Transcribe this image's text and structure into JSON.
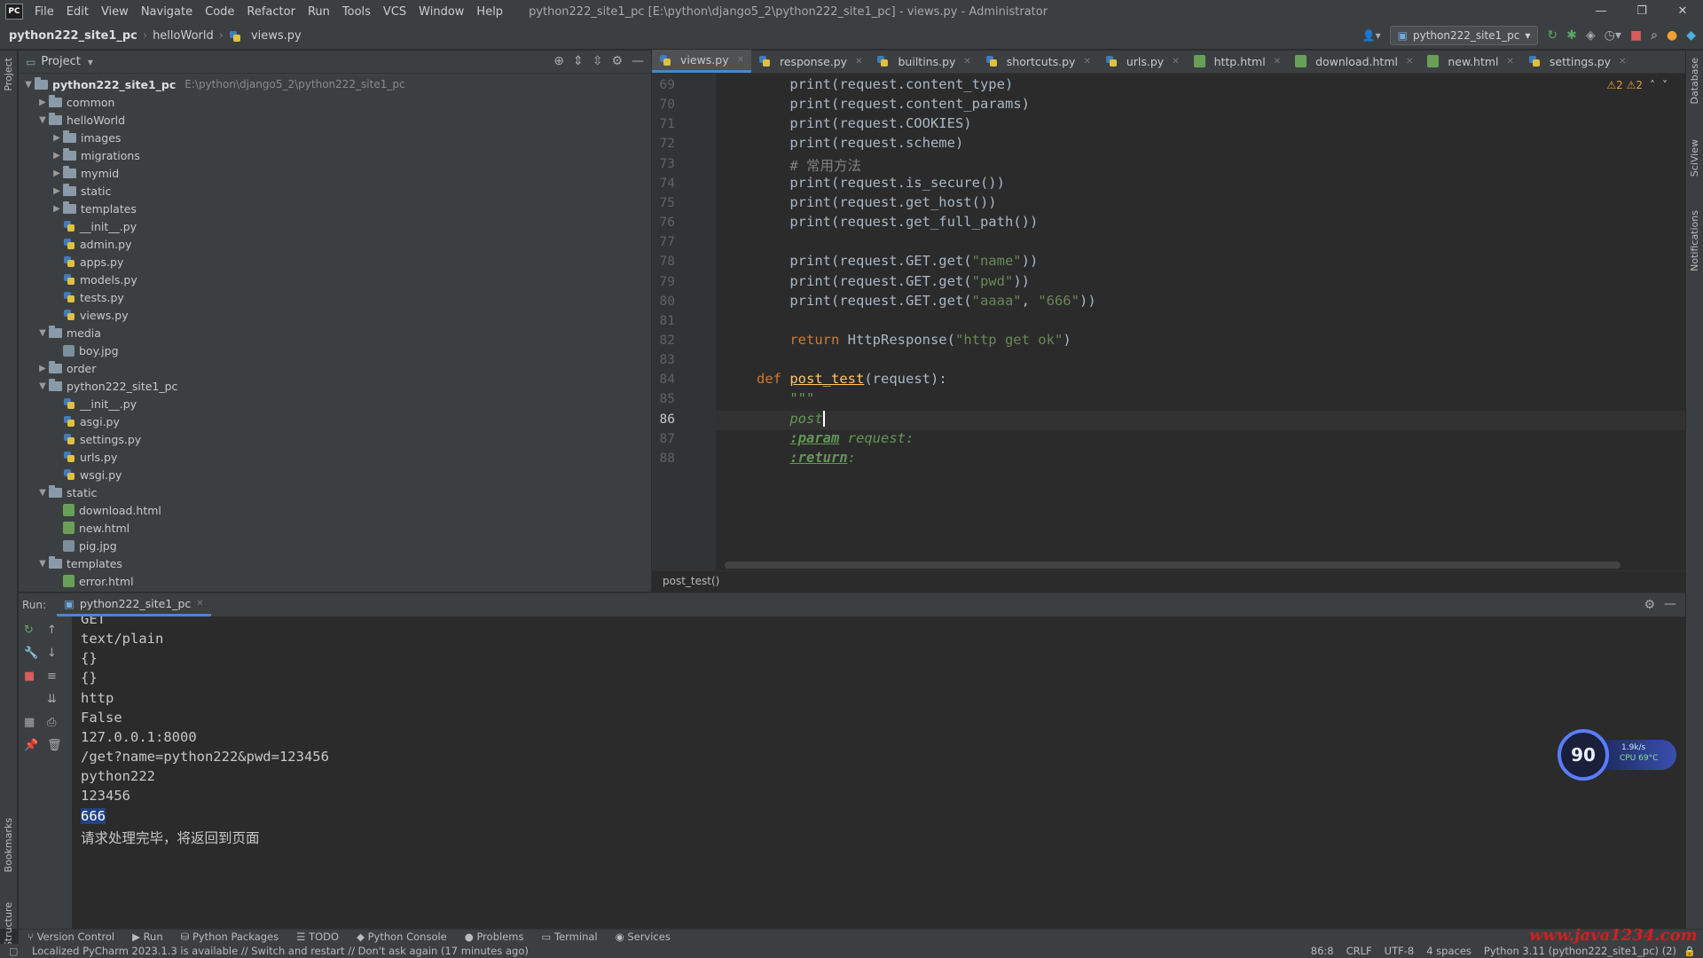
{
  "app": {
    "logo": "PC",
    "menu": [
      "File",
      "Edit",
      "View",
      "Navigate",
      "Code",
      "Refactor",
      "Run",
      "Tools",
      "VCS",
      "Window",
      "Help"
    ],
    "window_title": "python222_site1_pc [E:\\python\\django5_2\\python222_site1_pc] - views.py - Administrator"
  },
  "nav": {
    "project": "python222_site1_pc",
    "folder": "helloWorld",
    "file": "views.py",
    "run_config": "python222_site1_pc"
  },
  "project_panel": {
    "title": "Project",
    "root_name": "python222_site1_pc",
    "root_path": "E:\\python\\django5_2\\python222_site1_pc",
    "items": [
      {
        "name": "common",
        "type": "folder",
        "depth": 1,
        "open": false
      },
      {
        "name": "helloWorld",
        "type": "folder",
        "depth": 1,
        "open": true
      },
      {
        "name": "images",
        "type": "folder",
        "depth": 2,
        "open": false
      },
      {
        "name": "migrations",
        "type": "folder",
        "depth": 2,
        "open": false
      },
      {
        "name": "mymid",
        "type": "folder",
        "depth": 2,
        "open": false
      },
      {
        "name": "static",
        "type": "folder",
        "depth": 2,
        "open": false
      },
      {
        "name": "templates",
        "type": "folder",
        "depth": 2,
        "open": false
      },
      {
        "name": "__init__.py",
        "type": "py",
        "depth": 2
      },
      {
        "name": "admin.py",
        "type": "py",
        "depth": 2
      },
      {
        "name": "apps.py",
        "type": "py",
        "depth": 2
      },
      {
        "name": "models.py",
        "type": "py",
        "depth": 2
      },
      {
        "name": "tests.py",
        "type": "py",
        "depth": 2
      },
      {
        "name": "views.py",
        "type": "py",
        "depth": 2
      },
      {
        "name": "media",
        "type": "folder",
        "depth": 1,
        "open": true
      },
      {
        "name": "boy.jpg",
        "type": "img",
        "depth": 2
      },
      {
        "name": "order",
        "type": "folder",
        "depth": 1,
        "open": false
      },
      {
        "name": "python222_site1_pc",
        "type": "folder",
        "depth": 1,
        "open": true
      },
      {
        "name": "__init__.py",
        "type": "py",
        "depth": 2
      },
      {
        "name": "asgi.py",
        "type": "py",
        "depth": 2
      },
      {
        "name": "settings.py",
        "type": "py",
        "depth": 2
      },
      {
        "name": "urls.py",
        "type": "py",
        "depth": 2
      },
      {
        "name": "wsgi.py",
        "type": "py",
        "depth": 2
      },
      {
        "name": "static",
        "type": "folder",
        "depth": 1,
        "open": true
      },
      {
        "name": "download.html",
        "type": "html",
        "depth": 2
      },
      {
        "name": "new.html",
        "type": "html",
        "depth": 2
      },
      {
        "name": "pig.jpg",
        "type": "img",
        "depth": 2
      },
      {
        "name": "templates",
        "type": "folder",
        "depth": 1,
        "open": true
      },
      {
        "name": "error.html",
        "type": "html",
        "depth": 2
      }
    ]
  },
  "editor": {
    "tabs": [
      {
        "label": "views.py",
        "type": "py",
        "active": true
      },
      {
        "label": "response.py",
        "type": "py"
      },
      {
        "label": "builtins.py",
        "type": "py"
      },
      {
        "label": "shortcuts.py",
        "type": "py"
      },
      {
        "label": "urls.py",
        "type": "py"
      },
      {
        "label": "http.html",
        "type": "html"
      },
      {
        "label": "download.html",
        "type": "html"
      },
      {
        "label": "new.html",
        "type": "html"
      },
      {
        "label": "settings.py",
        "type": "py"
      }
    ],
    "warnings": "⚠2  ⚠2",
    "current_line": "86",
    "lines": [
      {
        "n": "69",
        "code": "    print(request.content_type)"
      },
      {
        "n": "70",
        "code": "    print(request.content_params)"
      },
      {
        "n": "71",
        "code": "    print(request.COOKIES)"
      },
      {
        "n": "72",
        "code": "    print(request.scheme)"
      },
      {
        "n": "73",
        "code": "    # 常用方法"
      },
      {
        "n": "74",
        "code": "    print(request.is_secure())"
      },
      {
        "n": "75",
        "code": "    print(request.get_host())"
      },
      {
        "n": "76",
        "code": "    print(request.get_full_path())"
      },
      {
        "n": "77",
        "code": ""
      },
      {
        "n": "78",
        "code": "    print(request.GET.get(\"name\"))"
      },
      {
        "n": "79",
        "code": "    print(request.GET.get(\"pwd\"))"
      },
      {
        "n": "80",
        "code": "    print(request.GET.get(\"aaaa\", \"666\"))"
      },
      {
        "n": "81",
        "code": ""
      },
      {
        "n": "82",
        "code": "    return HttpResponse(\"http get ok\")"
      },
      {
        "n": "83",
        "code": ""
      },
      {
        "n": "84",
        "code": "def post_test(request):"
      },
      {
        "n": "85",
        "code": "    \"\"\""
      },
      {
        "n": "86",
        "code": "    post"
      },
      {
        "n": "87",
        "code": "    :param request:"
      },
      {
        "n": "88",
        "code": "    :return:"
      }
    ],
    "breadcrumb": "post_test()"
  },
  "run": {
    "label": "Run:",
    "tab": "python222_site1_pc",
    "output": [
      "GET",
      "text/plain",
      "{}",
      "{}",
      "http",
      "False",
      "127.0.0.1:8000",
      "/get?name=python222&pwd=123456",
      "python222",
      "123456",
      "666",
      "请求处理完毕，将返回到页面"
    ],
    "selected_line": "666"
  },
  "bottom_tabs": [
    "Version Control",
    "Run",
    "Python Packages",
    "TODO",
    "Python Console",
    "Problems",
    "Terminal",
    "Services"
  ],
  "status": {
    "message": "Localized PyCharm 2023.1.3 is available // Switch and restart // Don't ask again (17 minutes ago)",
    "position": "86:8",
    "line_sep": "CRLF",
    "encoding": "UTF-8",
    "indent": "4 spaces",
    "interpreter": "Python 3.11 (python222_site1_pc) (2)"
  },
  "side_labels": {
    "project": "Project",
    "bookmarks": "Bookmarks",
    "structure": "Structure",
    "database": "Database",
    "sciview": "SciView",
    "notifications": "Notifications"
  },
  "widget": {
    "value": "90",
    "net": "1.9k/s",
    "cpu": "CPU 69°C"
  },
  "watermark": "www.java1234.com"
}
